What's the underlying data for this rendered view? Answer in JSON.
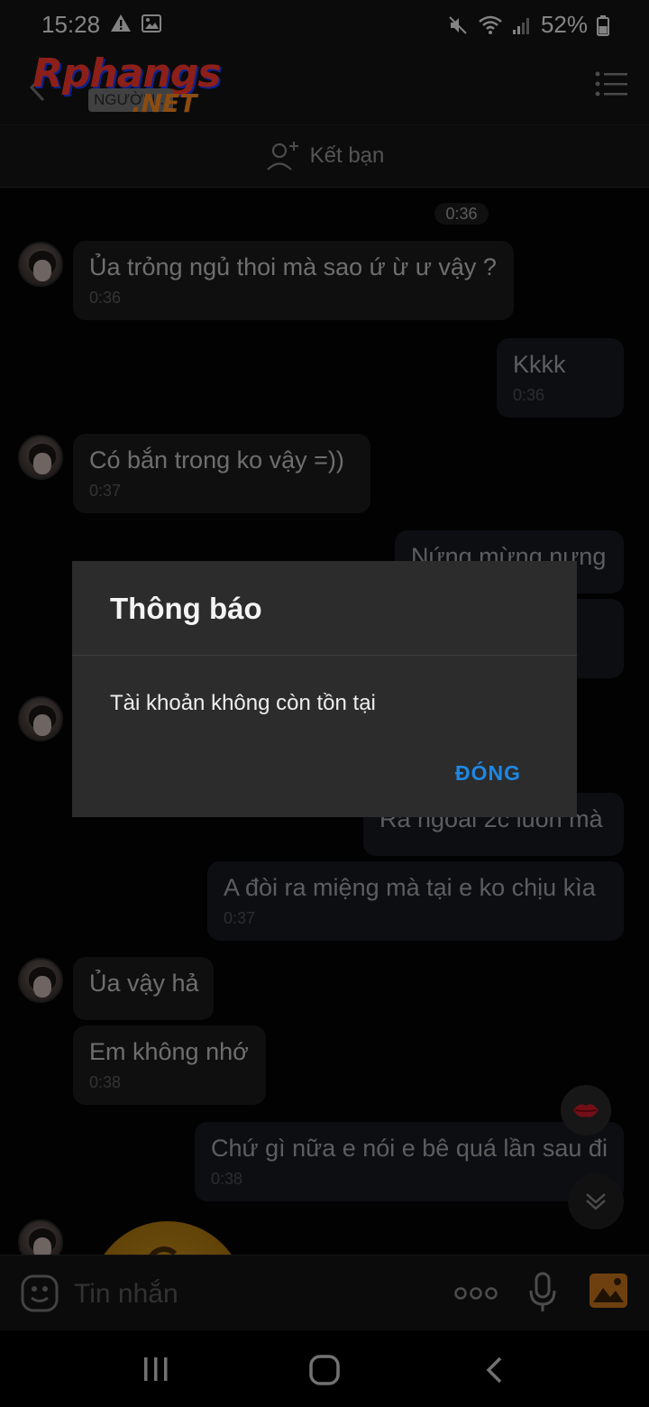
{
  "status_bar": {
    "time": "15:28",
    "battery": "52%"
  },
  "header": {
    "watermark_main": "Rphangs",
    "watermark_sub": "NGƯỜI L...",
    "watermark_domain": ".NET"
  },
  "add_friend": {
    "label": "Kết bạn"
  },
  "chat": {
    "time_divider": "0:36",
    "messages": [
      {
        "text": "Ủa trỏng ngủ thoi mà sao ứ ừ ư vậy ?",
        "time": "0:36"
      },
      {
        "text": "Kkkk",
        "time": "0:36"
      },
      {
        "text": " Có bắn trong ko vậy =))",
        "time": "0:37"
      },
      {
        "text": "Nứng mừng nưng",
        "time": ""
      },
      {
        "text": "Ra ngoài 2c luôn mà",
        "time": ""
      },
      {
        "text": "A đòi ra miệng mà tại e ko chịu kìa",
        "time": "0:37"
      },
      {
        "text": "Ủa vậy hả",
        "time": ""
      },
      {
        "text": "Em không nhớ",
        "time": "0:38"
      },
      {
        "text": "Chứ gì nữa e nói e bê quá lần sau đi",
        "time": "0:38"
      }
    ]
  },
  "dialog": {
    "title": "Thông báo",
    "message": "Tài khoản không còn tồn tại",
    "button": "ĐÓNG"
  },
  "input_bar": {
    "placeholder": "Tin nhắn"
  },
  "colors": {
    "accent": "#1e88e5",
    "dialog_bg": "#2c2c2c",
    "incoming_bubble": "#1d1d1d",
    "outgoing_bubble": "#161a22"
  }
}
